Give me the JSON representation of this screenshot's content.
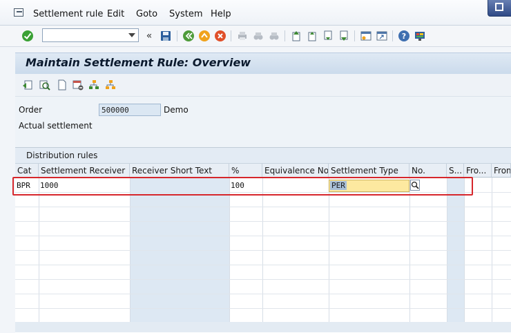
{
  "menu": {
    "items": [
      "Settlement rule",
      "Edit",
      "Goto",
      "System",
      "Help"
    ]
  },
  "title": "Maintain Settlement Rule: Overview",
  "fields": {
    "order_label": "Order",
    "order_value": "500000",
    "order_desc": "Demo",
    "actual_label": "Actual settlement"
  },
  "table": {
    "section_title": "Distribution rules",
    "columns": [
      "Cat",
      "Settlement Receiver",
      "Receiver Short Text",
      "%",
      "Equivalence No.",
      "Settlement Type",
      "No.",
      "S...",
      "Fro...",
      "From"
    ],
    "rows": [
      {
        "cat": "BPR",
        "receiver": "1000",
        "short_text": "",
        "percent": "100",
        "equiv": "",
        "type": "PER",
        "no": "",
        "s": "",
        "fro": "",
        "from": ""
      }
    ]
  },
  "colors": {
    "highlight_border": "#d6262b",
    "type_field_bg": "#fde9a0",
    "title_bar": "#cbdbec"
  }
}
